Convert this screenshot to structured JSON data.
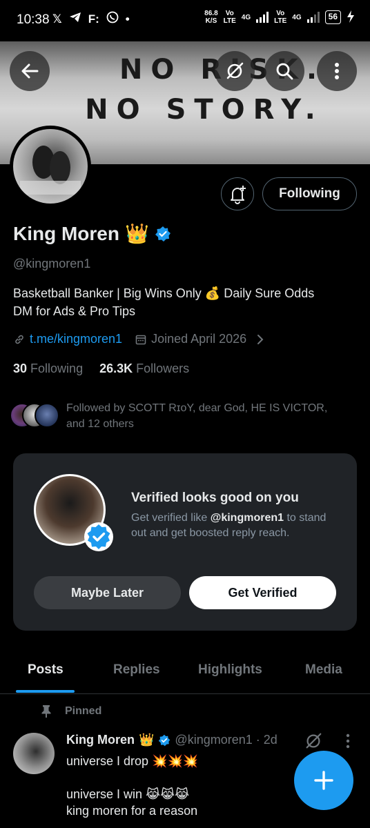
{
  "status_bar": {
    "time": "10:38",
    "speed_value": "86.8",
    "speed_unit": "K/S",
    "sim1_vo": "Vo",
    "sim1_lte": "LTE",
    "net1": "4G",
    "sim2_vo": "Vo",
    "sim2_lte": "LTE",
    "net2": "4G",
    "battery": "56",
    "icons": [
      "x-icon",
      "telegram-icon",
      "f-icon",
      "whatsapp-icon",
      "dot-icon"
    ]
  },
  "banner": {
    "line1": "NO RISK.",
    "line2": "NO STORY."
  },
  "profile": {
    "following_button": "Following",
    "name": "King Moren",
    "name_emoji": "👑",
    "handle": "@kingmoren1",
    "bio_line1": "Basketball Banker | Big Wins Only 💰 Daily Sure Odds",
    "bio_line2": "DM for Ads & Pro Tips",
    "link": "t.me/kingmoren1",
    "joined": "Joined April 2026",
    "following_count": "30",
    "following_label": "Following",
    "followers_count": "26.3K",
    "followers_label": "Followers",
    "followed_by_line1": "Followed by SCOTT RɪᴏY, dear God, HE IS VICTOR,",
    "followed_by_line2": "and 12 others"
  },
  "verified_card": {
    "title": "Verified looks good on you",
    "sub_prefix": "Get verified like ",
    "sub_handle": "@kingmoren1",
    "sub_suffix": " to stand out and get boosted reply reach.",
    "maybe_later": "Maybe Later",
    "get_verified": "Get Verified"
  },
  "tabs": [
    "Posts",
    "Replies",
    "Highlights",
    "Media"
  ],
  "post": {
    "pinned_label": "Pinned",
    "author": "King Moren",
    "author_emoji": "👑",
    "handle_time": "@kingmoren1 · 2d",
    "line1": "universe I drop 💥💥💥",
    "line2": "",
    "line3": "universe I win 😹😹😹",
    "line4": "king moren for a reason"
  },
  "colors": {
    "accent": "#1d9bf0",
    "background": "#000000",
    "muted": "#71767b",
    "card": "#202327"
  }
}
